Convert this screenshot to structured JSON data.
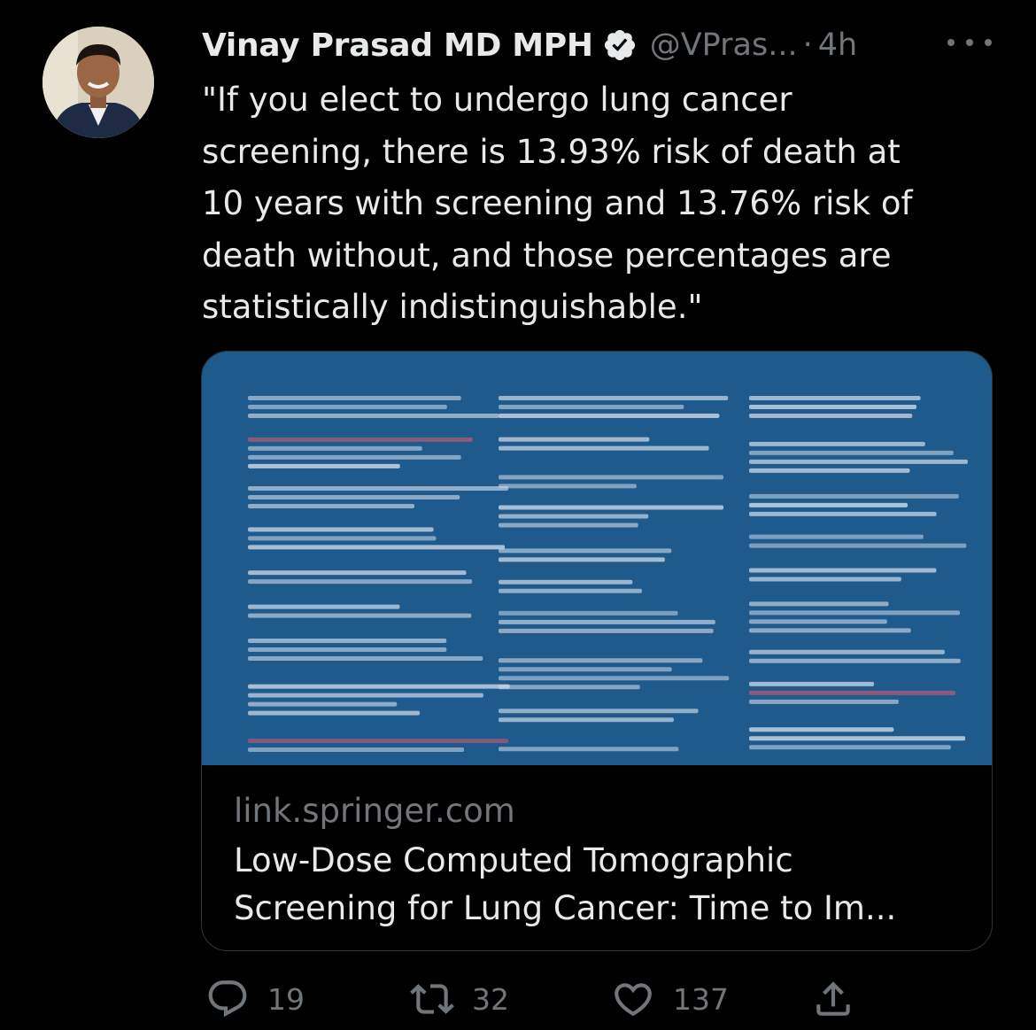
{
  "tweet": {
    "author_name": "Vinay Prasad MD MPH",
    "handle": "@VPras...",
    "separator": "·",
    "time": "4h",
    "text": "\"If you elect to undergo lung cancer\nscreening, there is 13.93% risk of death at\n10 years with screening and 13.76% risk of\ndeath without, and those percentages are\nstatistically indistinguishable.\""
  },
  "card": {
    "domain": "link.springer.com",
    "title": "Low-Dose Computed Tomographic\nScreening for Lung Cancer: Time to Im..."
  },
  "actions": {
    "reply_count": "19",
    "retweet_count": "32",
    "like_count": "137"
  },
  "icons": {
    "verified": "verified-badge-icon",
    "more": "more-icon",
    "reply": "reply-icon",
    "retweet": "retweet-icon",
    "like": "like-icon",
    "share": "share-icon"
  },
  "colors": {
    "background": "#000000",
    "primary_text": "#e7e9ea",
    "secondary_text": "#71767b",
    "card_border": "#2f3336",
    "card_image_blue": "#1f5a8c"
  }
}
